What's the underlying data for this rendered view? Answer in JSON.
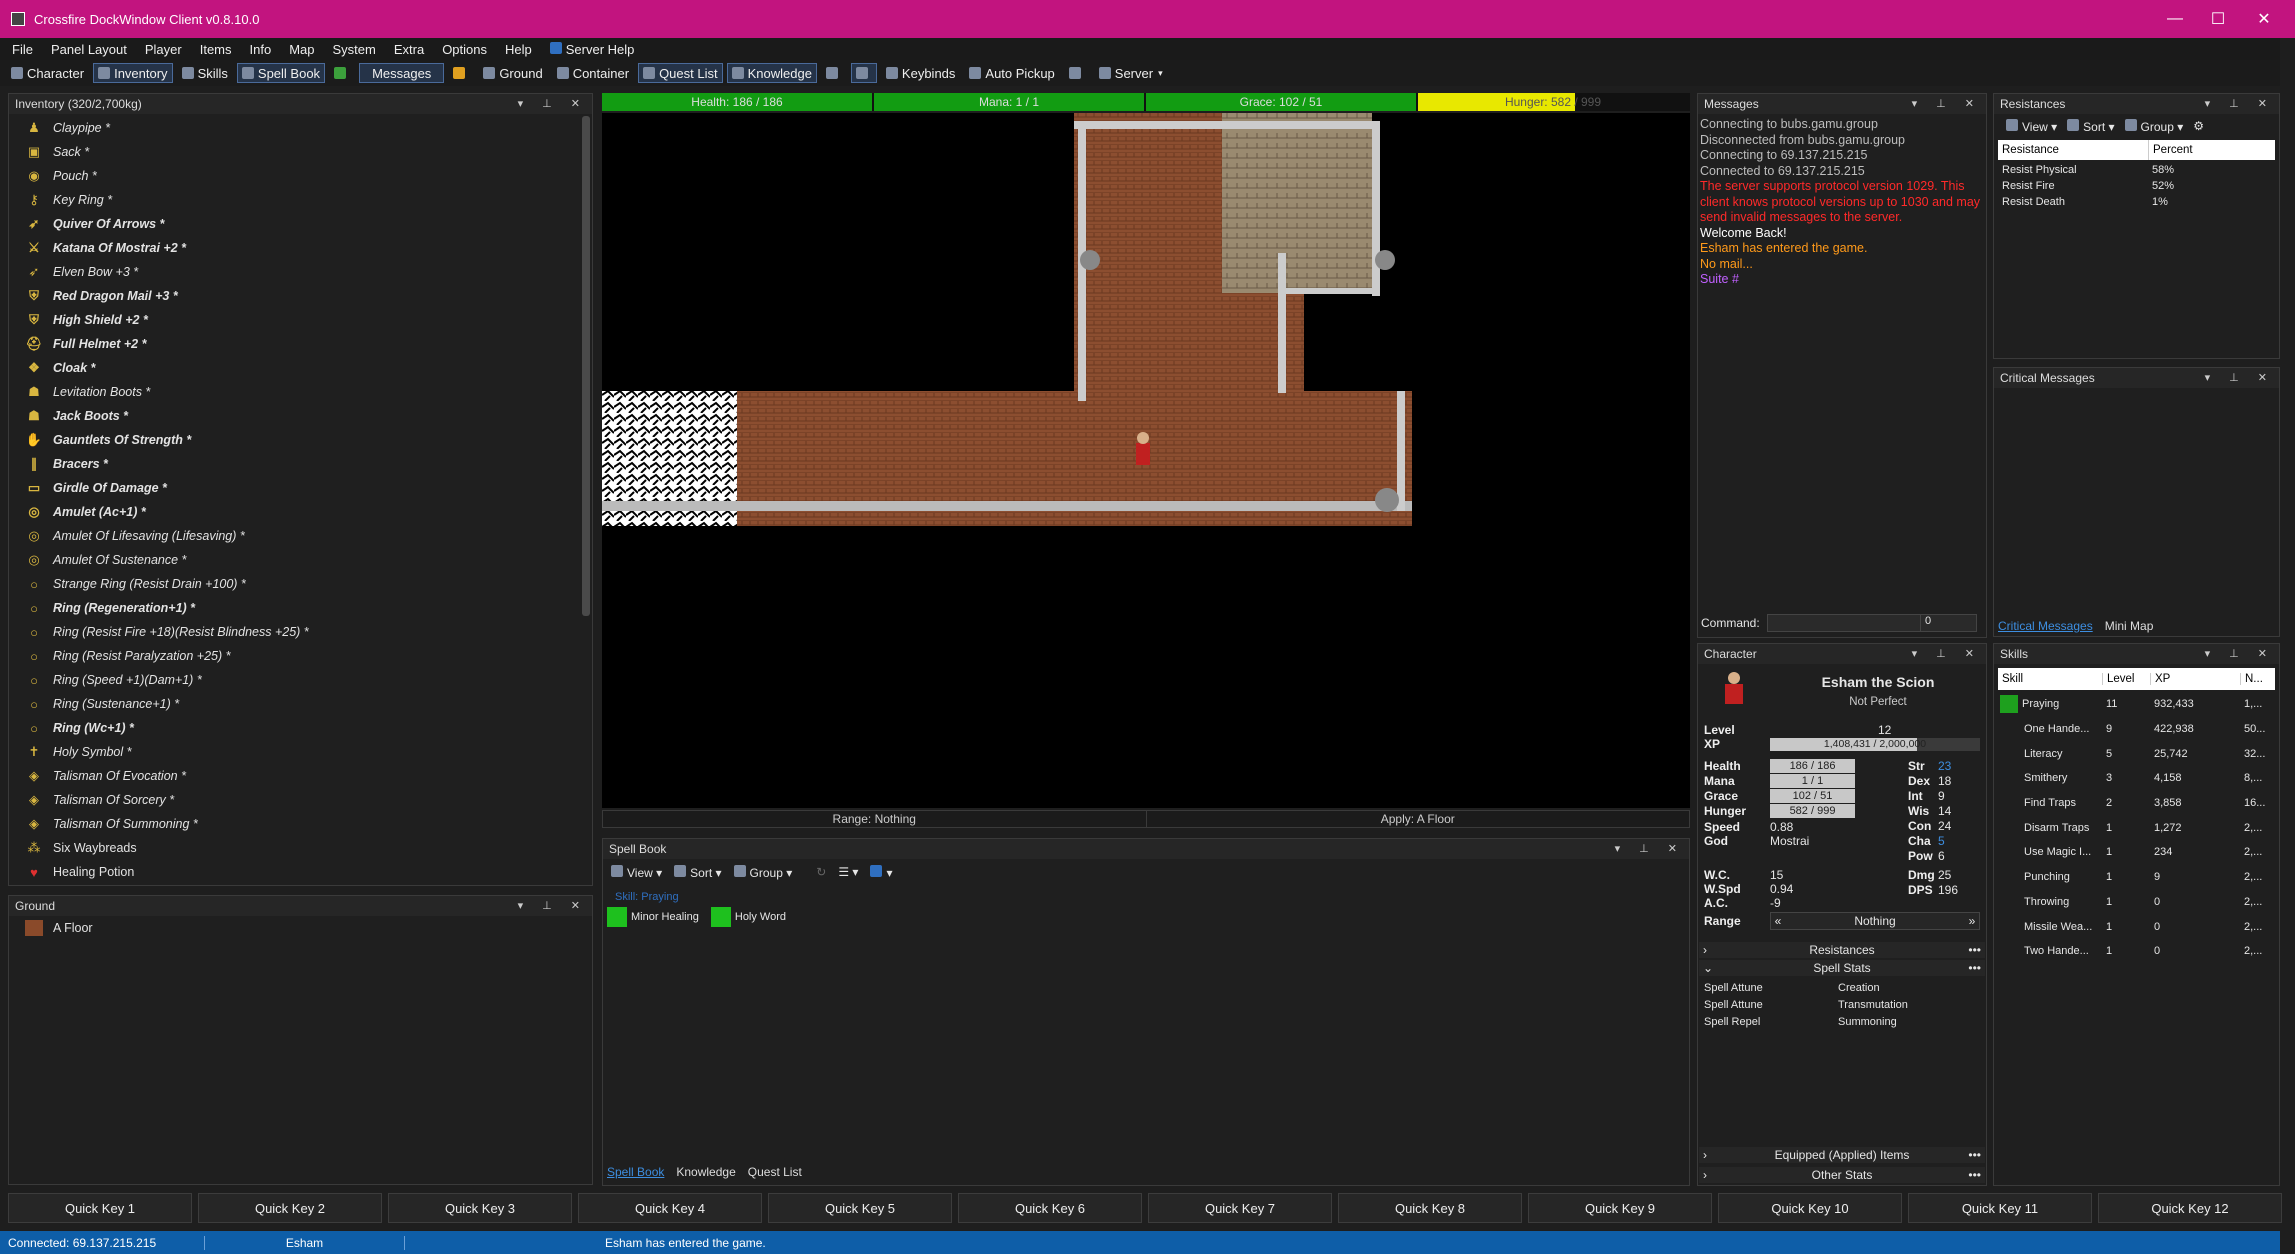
{
  "window": {
    "title": "Crossfire DockWindow Client v0.8.10.0",
    "minimize": "—",
    "maximize": "☐",
    "close": "✕"
  },
  "menu": [
    "File",
    "Panel Layout",
    "Player",
    "Items",
    "Info",
    "Map",
    "System",
    "Extra",
    "Options",
    "Help",
    "Server Help"
  ],
  "toolbar": {
    "character": "Character",
    "inventory": "Inventory",
    "skills": "Skills",
    "spellbook": "Spell Book",
    "messages": "Messages",
    "ground": "Ground",
    "container": "Container",
    "questlist": "Quest List",
    "knowledge": "Knowledge",
    "keybinds": "Keybinds",
    "autopickup": "Auto Pickup",
    "server": "Server"
  },
  "inventory": {
    "title": "Inventory (320/2,700kg)",
    "items": [
      {
        "name": "Claypipe *",
        "style": "i"
      },
      {
        "name": "Sack *",
        "style": "i"
      },
      {
        "name": "Pouch *",
        "style": "i"
      },
      {
        "name": "Key Ring *",
        "style": "i"
      },
      {
        "name": "Quiver Of Arrows *",
        "style": "b"
      },
      {
        "name": "Katana Of Mostrai +2 *",
        "style": "b"
      },
      {
        "name": "Elven Bow +3 *",
        "style": "i"
      },
      {
        "name": "Red Dragon Mail +3 *",
        "style": "b"
      },
      {
        "name": "High Shield +2 *",
        "style": "b"
      },
      {
        "name": "Full Helmet +2 *",
        "style": "b"
      },
      {
        "name": "Cloak *",
        "style": "b"
      },
      {
        "name": "Levitation Boots *",
        "style": "i"
      },
      {
        "name": "Jack Boots *",
        "style": "b"
      },
      {
        "name": "Gauntlets Of Strength *",
        "style": "b"
      },
      {
        "name": "Bracers *",
        "style": "b"
      },
      {
        "name": "Girdle Of Damage *",
        "style": "b"
      },
      {
        "name": "Amulet (Ac+1) *",
        "style": "b"
      },
      {
        "name": "Amulet Of Lifesaving (Lifesaving) *",
        "style": "i"
      },
      {
        "name": "Amulet Of Sustenance *",
        "style": "i"
      },
      {
        "name": "Strange Ring (Resist Drain +100) *",
        "style": "i"
      },
      {
        "name": "Ring (Regeneration+1) *",
        "style": "b"
      },
      {
        "name": "Ring (Resist Fire +18)(Resist Blindness +25) *",
        "style": "i"
      },
      {
        "name": "Ring (Resist Paralyzation +25) *",
        "style": "i"
      },
      {
        "name": "Ring (Speed +1)(Dam+1) *",
        "style": "i"
      },
      {
        "name": "Ring (Sustenance+1) *",
        "style": "i"
      },
      {
        "name": "Ring (Wc+1) *",
        "style": "b"
      },
      {
        "name": "Holy Symbol *",
        "style": "i"
      },
      {
        "name": "Talisman Of Evocation *",
        "style": "i"
      },
      {
        "name": "Talisman Of Sorcery *",
        "style": "i"
      },
      {
        "name": "Talisman Of Summoning *",
        "style": "i"
      },
      {
        "name": "Six Waybreads",
        "style": "n"
      },
      {
        "name": "Healing Potion",
        "style": "n"
      }
    ]
  },
  "ground": {
    "title": "Ground",
    "item": "A Floor"
  },
  "statbars": {
    "health": "Health: 186 / 186",
    "mana": "Mana: 1 / 1",
    "grace": "Grace: 102 / 51",
    "hunger": "Hunger: 582 / 999",
    "hunger_fill": 0.58
  },
  "map": {
    "range": "Range: Nothing",
    "apply": "Apply: A Floor"
  },
  "spellbook": {
    "title": "Spell Book",
    "view": "View",
    "sort": "Sort",
    "group": "Group",
    "skill": "Skill: Praying",
    "spells": [
      "Minor Healing",
      "Holy Word"
    ],
    "tabs": [
      "Spell Book",
      "Knowledge",
      "Quest List"
    ]
  },
  "messages": {
    "title": "Messages",
    "lines": [
      {
        "t": "Connecting to bubs.gamu.group",
        "c": "#bdbdbd"
      },
      {
        "t": "Disconnected from bubs.gamu.group",
        "c": "#bdbdbd"
      },
      {
        "t": "Connecting to 69.137.215.215",
        "c": "#bdbdbd"
      },
      {
        "t": "Connected to 69.137.215.215",
        "c": "#bdbdbd"
      },
      {
        "t": "The server supports protocol version 1029. This client knows protocol versions up to 1030 and may send invalid messages to the server.",
        "c": "#ff2a2a"
      },
      {
        "t": "Welcome Back!",
        "c": "#ffffff"
      },
      {
        "t": "Esham has entered the game.",
        "c": "#ff9a1a"
      },
      {
        "t": "No mail...",
        "c": "#ff9a1a"
      },
      {
        "t": "Suite #",
        "c": "#c060ff"
      }
    ],
    "command_label": "Command:",
    "command_value": "0"
  },
  "character": {
    "title": "Character",
    "name": "Esham the Scion",
    "subtitle": "Not Perfect",
    "level_label": "Level",
    "level": "12",
    "xp_label": "XP",
    "xp": "1,408,431 / 2,000,000",
    "xp_fill": 0.7,
    "health_label": "Health",
    "health": "186 / 186",
    "mana_label": "Mana",
    "mana": "1 / 1",
    "grace_label": "Grace",
    "grace": "102 / 51",
    "hunger_label": "Hunger",
    "hunger": "582 / 999",
    "speed_label": "Speed",
    "speed": "0.88",
    "god_label": "God",
    "god": "Mostrai",
    "str": "23",
    "dex": "18",
    "int": "9",
    "wis": "14",
    "con": "24",
    "cha": "5",
    "pow": "6",
    "wc_label": "W.C.",
    "wc": "15",
    "wspd_label": "W.Spd",
    "wspd": "0.94",
    "ac_label": "A.C.",
    "ac": "-9",
    "dmg": "25",
    "dps": "196",
    "range_label": "Range",
    "range": "Nothing",
    "resistances": "Resistances",
    "spellstats": "Spell Stats",
    "spell_rows": [
      [
        "Spell Attune",
        "Creation"
      ],
      [
        "Spell Attune",
        "Transmutation"
      ],
      [
        "Spell Repel",
        "Summoning"
      ]
    ],
    "equipped": "Equipped (Applied) Items",
    "other": "Other Stats"
  },
  "resist": {
    "title": "Resistances",
    "view": "View",
    "sort": "Sort",
    "group": "Group",
    "cols": [
      "Resistance",
      "Percent"
    ],
    "rows": [
      [
        "Resist Physical",
        "58%"
      ],
      [
        "Resist Fire",
        "52%"
      ],
      [
        "Resist Death",
        "1%"
      ]
    ]
  },
  "critical": {
    "title": "Critical Messages",
    "tabs": [
      "Critical Messages",
      "Mini Map"
    ]
  },
  "skills": {
    "title": "Skills",
    "cols": [
      "Skill",
      "Level",
      "XP",
      "N..."
    ],
    "rows": [
      [
        "Praying",
        "11",
        "932,433",
        "1,..."
      ],
      [
        "One Hande...",
        "9",
        "422,938",
        "50..."
      ],
      [
        "Literacy",
        "5",
        "25,742",
        "32..."
      ],
      [
        "Smithery",
        "3",
        "4,158",
        "8,..."
      ],
      [
        "Find Traps",
        "2",
        "3,858",
        "16..."
      ],
      [
        "Disarm Traps",
        "1",
        "1,272",
        "2,..."
      ],
      [
        "Use Magic I...",
        "1",
        "234",
        "2,..."
      ],
      [
        "Punching",
        "1",
        "9",
        "2,..."
      ],
      [
        "Throwing",
        "1",
        "0",
        "2,..."
      ],
      [
        "Missile Wea...",
        "1",
        "0",
        "2,..."
      ],
      [
        "Two Hande...",
        "1",
        "0",
        "2,..."
      ]
    ]
  },
  "quickkeys": [
    "Quick Key 1",
    "Quick Key 2",
    "Quick Key 3",
    "Quick Key 4",
    "Quick Key 5",
    "Quick Key 6",
    "Quick Key 7",
    "Quick Key 8",
    "Quick Key 9",
    "Quick Key 10",
    "Quick Key 11",
    "Quick Key 12"
  ],
  "status": {
    "connected": "Connected: 69.137.215.215",
    "player": "Esham",
    "msg": "Esham has entered the game."
  }
}
